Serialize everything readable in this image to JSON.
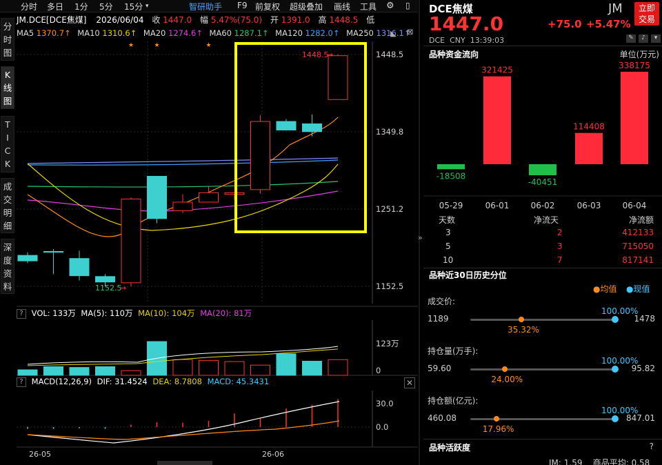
{
  "toolbar": {
    "items": [
      "分时",
      "多日",
      "1分",
      "5分",
      "15分",
      "智研助手",
      "F9",
      "前复权",
      "超级叠加",
      "画线",
      "工具"
    ],
    "arrow": "▾"
  },
  "quote": {
    "symbol": "JM.DCE[DCE焦煤]",
    "date": "2026/06/04",
    "close_label": "收",
    "close": "1447.0",
    "change_label": "幅",
    "change": "5.47%(75.0)",
    "open_label": "开",
    "open": "1391.0",
    "high_label": "高",
    "high": "1448.5",
    "low_label": "低"
  },
  "ma_row": {
    "items": [
      {
        "label": "MA5",
        "value": "1370.7↑",
        "color": "#ff8c1a"
      },
      {
        "label": "MA10",
        "value": "1310.6↑",
        "color": "#e8d400"
      },
      {
        "label": "MA20",
        "value": "1274.6↑",
        "color": "#e040e0"
      },
      {
        "label": "MA60",
        "value": "1287.1↑",
        "color": "#2cc36b"
      },
      {
        "label": "MA120",
        "value": "1282.0↑",
        "color": "#41a0ff"
      },
      {
        "label": "MA250",
        "value": "1316.1↑",
        "color": "#7f8cff"
      }
    ]
  },
  "side_tabs": [
    "分时图",
    "K线图",
    "TICK",
    "成交明细",
    "深度资料"
  ],
  "main_axis": [
    "1448.5",
    "1349.8",
    "1251.2",
    "1152.5"
  ],
  "annotations": {
    "high": "1448.5",
    "low": "1152.5",
    "star": "★"
  },
  "volume": {
    "header_items": [
      {
        "text": "VOL: 133万",
        "color": "#ffffff"
      },
      {
        "text": "MA(5): 110万",
        "color": "#ffffff"
      },
      {
        "text": "MA(10): 104万",
        "color": "#e8d400"
      },
      {
        "text": "MA(20): 81万",
        "color": "#e040e0"
      }
    ],
    "axis": [
      "123万",
      "0"
    ]
  },
  "macd": {
    "header_items": [
      {
        "text": "MACD(12,26,9)",
        "color": "#ffffff"
      },
      {
        "text": "DIF: 31.4524",
        "color": "#ffffff"
      },
      {
        "text": "DEA: 8.7808",
        "color": "#e8d400"
      },
      {
        "text": "MACD: 45.3431",
        "color": "#41c8ff"
      }
    ],
    "axis": [
      "30.0",
      "0.0"
    ]
  },
  "x_labels": [
    "26-05",
    "26-06"
  ],
  "chart_data": [
    {
      "type": "candlestick",
      "title": "JM.DCE[DCE焦煤]",
      "ylim": [
        1152.5,
        1448.5
      ],
      "candles": [
        {
          "open": 1192,
          "close": 1185,
          "high": 1196,
          "low": 1182
        },
        {
          "open": 1197,
          "close": 1196,
          "high": 1200,
          "low": 1168
        },
        {
          "open": 1188,
          "close": 1166,
          "high": 1198,
          "low": 1160
        },
        {
          "open": 1165,
          "close": 1158,
          "high": 1168,
          "low": 1152.5
        },
        {
          "open": 1157,
          "close": 1264,
          "high": 1266,
          "low": 1152.5
        },
        {
          "open": 1293,
          "close": 1239,
          "high": 1293,
          "low": 1233
        },
        {
          "open": 1249,
          "close": 1260,
          "high": 1270,
          "low": 1246
        },
        {
          "open": 1260,
          "close": 1272,
          "high": 1280,
          "low": 1260
        },
        {
          "open": 1270,
          "close": 1272,
          "high": 1273,
          "low": 1263
        },
        {
          "open": 1276,
          "close": 1363,
          "high": 1371,
          "low": 1271
        },
        {
          "open": 1363,
          "close": 1352,
          "high": 1366,
          "low": 1352
        },
        {
          "open": 1360,
          "close": 1350,
          "high": 1372,
          "low": 1344
        },
        {
          "open": 1391,
          "close": 1447,
          "high": 1448.5,
          "low": 1391
        }
      ],
      "stars_on_candles": [
        4,
        5,
        7
      ]
    },
    {
      "type": "bar",
      "title": "VOL",
      "units": "万",
      "values": [
        14,
        22,
        20,
        22,
        12,
        86,
        40,
        38,
        35,
        26,
        55,
        36,
        40,
        56
      ],
      "ylim": [
        0,
        123
      ]
    },
    {
      "type": "bar",
      "title": "MACD",
      "values": [
        -3,
        -3,
        -2,
        -3,
        4,
        8,
        7,
        10,
        22,
        14,
        30,
        36,
        45
      ],
      "ylim": [
        -20,
        45
      ]
    },
    {
      "type": "bar",
      "title": "品种资金流向",
      "unit": "万元",
      "categories": [
        "05-29",
        "06-01",
        "06-02",
        "06-03",
        "06-04"
      ],
      "values": [
        -18508,
        321425,
        -40451,
        114408,
        338175
      ]
    }
  ],
  "right_panel": {
    "code": "JM",
    "name": "DCE焦煤",
    "price": "1447.0",
    "change": "+75.0",
    "change_pct": "+5.47%",
    "meta": "DCE  CNY  13:39:03",
    "trade_button": "立即交易",
    "fund_flow_title": "品种资金流向",
    "fund_flow_unit": "单位(万元)",
    "flow_values": [
      "-18508",
      "321425",
      "-40451",
      "114408",
      "338175"
    ],
    "flow_dates": [
      "05-29",
      "06-01",
      "06-02",
      "06-03",
      "06-04"
    ],
    "flow_table": {
      "headers": [
        "天数",
        "净流天",
        "净流额"
      ],
      "rows": [
        [
          "3",
          "2",
          "412133"
        ],
        [
          "5",
          "3",
          "715050"
        ],
        [
          "10",
          "7",
          "817141"
        ]
      ]
    },
    "hist_title": "品种近30日历史分位",
    "legend_avg": "●均值",
    "legend_cur": "●现值",
    "hist": [
      {
        "label": "成交价:",
        "min": "1189",
        "max": "1478",
        "avg_pct": "35.32%",
        "cur_pct": "100.00%",
        "avg": 0.3532,
        "cur": 1.0
      },
      {
        "label": "持仓量(万手):",
        "min": "59.60",
        "max": "95.82",
        "avg_pct": "24.00%",
        "cur_pct": "100.00%",
        "avg": 0.24,
        "cur": 1.0
      },
      {
        "label": "持仓额(亿元):",
        "min": "460.08",
        "max": "847.01",
        "avg_pct": "17.96%",
        "cur_pct": "100.00%",
        "avg": 0.1796,
        "cur": 1.0
      }
    ],
    "activity_title": "品种活跃度",
    "activity_hint": "?",
    "activity_preview": "JM: 1.59    商品平均: 0.58"
  },
  "colors": {
    "up": "#ff3333",
    "down": "#3ecfcf",
    "accent": "#ff8c1a",
    "highlight": "#ffff00"
  }
}
